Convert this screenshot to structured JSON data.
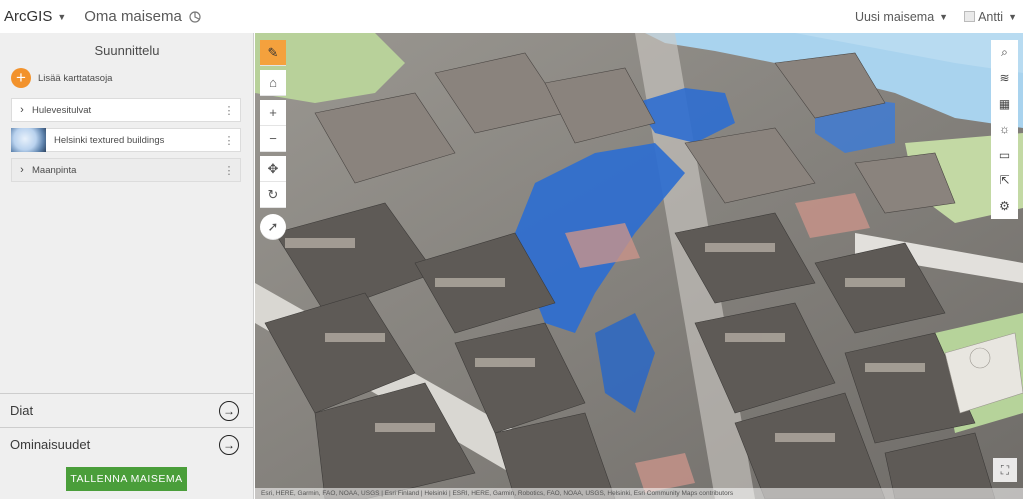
{
  "header": {
    "app_name": "ArcGIS",
    "scene_title": "Oma maisema",
    "new_scene_label": "Uusi maisema",
    "user_name": "Antti"
  },
  "sidebar": {
    "title": "Suunnittelu",
    "add_layers_label": "Lisää karttatasoja",
    "layers": [
      {
        "label": "Hulevesitulvat",
        "type": "group"
      },
      {
        "label": "Helsinki textured buildings",
        "type": "thumbnail"
      },
      {
        "label": "Maanpinta",
        "type": "group"
      }
    ],
    "slides_label": "Diat",
    "properties_label": "Ominaisuudet",
    "save_label": "TALLENNA MAISEMA"
  },
  "map": {
    "left_tools": [
      "pencil-icon",
      "home-icon",
      "zoom-in-icon",
      "zoom-out-icon",
      "pan-icon",
      "rotate-icon",
      "compass-icon"
    ],
    "right_tools": [
      "search-icon",
      "layers-icon",
      "basemap-icon",
      "daylight-icon",
      "measure-icon",
      "share-icon",
      "settings-icon"
    ],
    "attribution": "Esri, HERE, Garmin, FAO, NOAA, USGS | Esri Finland | Helsinki | ESRI, HERE, Garmin, Robotics, FAO, NOAA, USGS, Helsinki, Esri Community Maps contributors"
  },
  "colors": {
    "accent": "#f2922c",
    "save_button": "#4a9e3a",
    "flood_water": "#2e6ed0",
    "sea": "#a9d3ee"
  }
}
